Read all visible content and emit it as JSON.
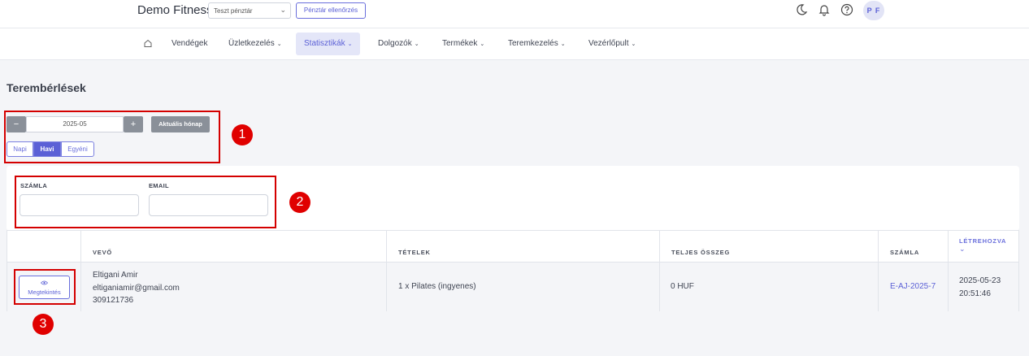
{
  "header": {
    "brand": "Demo Fitness",
    "cash_register_select": "Teszt pénztár",
    "cash_check_button": "Pénztár ellenőrzés",
    "avatar_initials": "P F",
    "icons": [
      "moon-icon",
      "bell-icon",
      "help-icon"
    ]
  },
  "nav": {
    "items": [
      {
        "label": "Vendégek"
      },
      {
        "label": "Üzletkezelés"
      },
      {
        "label": "Statisztikák"
      },
      {
        "label": "Dolgozók"
      },
      {
        "label": "Termékek"
      },
      {
        "label": "Teremkezelés"
      },
      {
        "label": "Vezérlőpult"
      }
    ],
    "active": "Statisztikák"
  },
  "page": {
    "title": "Terembérlések"
  },
  "period": {
    "minus": "−",
    "plus": "+",
    "month": "2025-05",
    "current_month_button": "Aktuális hónap",
    "modes": [
      "Napi",
      "Havi",
      "Egyéni"
    ],
    "active_mode": "Havi"
  },
  "filters": {
    "invoice_label": "SZÁMLA",
    "invoice_value": "",
    "email_label": "EMAIL",
    "email_value": ""
  },
  "table": {
    "columns": [
      "",
      "VEVŐ",
      "TÉTELEK",
      "TELJES ÖSSZEG",
      "SZÁMLA",
      "LÉTREHOZVA"
    ],
    "rows": [
      {
        "action": "Megtekintés",
        "customer_name": "Eltigani Amir",
        "customer_email": "eltiganiamir@gmail.com",
        "customer_phone": "309121736",
        "items": "1 x Pilates (ingyenes)",
        "total": "0 HUF",
        "invoice": "E-AJ-2025-7",
        "created_date": "2025-05-23",
        "created_time": "20:51:46"
      }
    ]
  },
  "annotations": [
    "1",
    "2",
    "3"
  ],
  "colors": {
    "accent": "#5b60d6",
    "annotation": "#e00000",
    "gray_button": "#8a9099"
  }
}
